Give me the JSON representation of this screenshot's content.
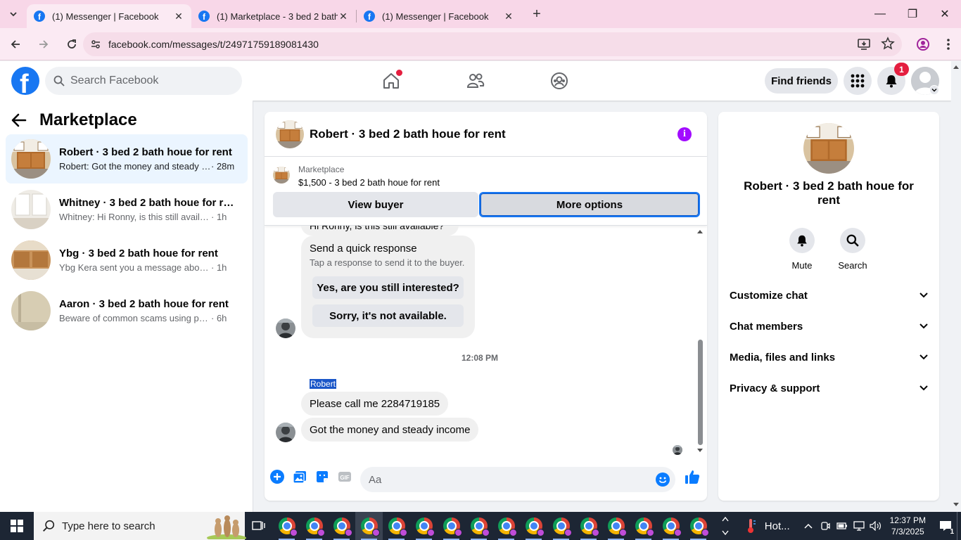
{
  "browser": {
    "tabs": [
      {
        "title": "(1) Messenger | Facebook",
        "active": true
      },
      {
        "title": "(1) Marketplace - 3 bed 2 bath h",
        "active": false
      },
      {
        "title": "(1) Messenger | Facebook",
        "active": false
      }
    ],
    "url": "facebook.com/messages/t/24971759189081430"
  },
  "fb_header": {
    "logo_letter": "f",
    "search_placeholder": "Search Facebook",
    "find_friends_label": "Find friends",
    "notification_count": "1"
  },
  "sidebar": {
    "title": "Marketplace",
    "conversations": [
      {
        "name": "Robert · 3 bed 2 bath houe for rent",
        "snippet": "Robert: Got the money and steady i...",
        "time": " · 28m",
        "active": true
      },
      {
        "name": "Whitney · 3 bed 2 bath houe for re...",
        "snippet": "Whitney: Hi Ronny, is this still availabl...",
        "time": " · 1h",
        "active": false
      },
      {
        "name": "Ybg · 3 bed 2 bath houe for rent",
        "snippet": "Ybg Kera sent you a message about y...",
        "time": " · 1h",
        "active": false
      },
      {
        "name": "Aaron · 3 bed 2 bath houe for rent",
        "snippet": "Beware of common scams using pay...",
        "time": " · 6h",
        "active": false
      }
    ]
  },
  "chat": {
    "title": "Robert · 3 bed 2 bath houe for rent",
    "marketplace_label": "Marketplace",
    "listing": "$1,500 - 3 bed 2 bath houe for rent",
    "view_buyer_label": "View buyer",
    "more_options_label": "More options",
    "partial_message": "Hi Ronny, is this still available?",
    "quick_response": {
      "title": "Send a quick response",
      "subtitle": "Tap a response to send it to the buyer.",
      "options": [
        "Yes, are you still interested?",
        "Sorry, it's not available."
      ]
    },
    "timestamp": "12:08 PM",
    "sender_name": "Robert",
    "messages": [
      "Please call me 2284719185",
      "Got the money and steady income"
    ],
    "input_placeholder": "Aa"
  },
  "info_panel": {
    "name": "Robert · 3 bed 2 bath houe for rent",
    "actions": [
      {
        "label": "Mute",
        "icon": "bell-icon"
      },
      {
        "label": "Search",
        "icon": "search-icon"
      }
    ],
    "sections": [
      "Customize chat",
      "Chat members",
      "Media, files and links",
      "Privacy & support"
    ]
  },
  "taskbar": {
    "search_placeholder": "Type here to search",
    "weather": "Hot...",
    "time": "12:37 PM",
    "date": "7/3/2025",
    "notification_count": "1"
  },
  "colors": {
    "fb_blue": "#1877f2",
    "messenger_purple": "#a20cff",
    "badge_red": "#e41e3f",
    "tab_pink": "#f8d7e8"
  }
}
